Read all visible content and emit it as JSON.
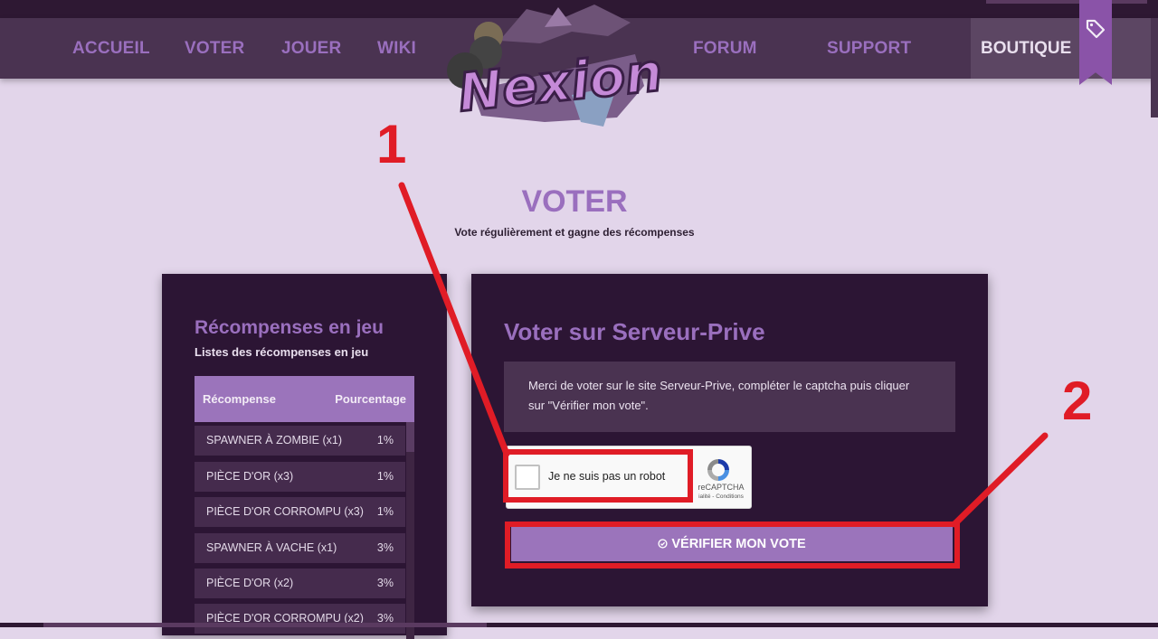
{
  "nav": {
    "items": [
      {
        "label": "ACCUEIL"
      },
      {
        "label": "VOTER"
      },
      {
        "label": "JOUER"
      },
      {
        "label": "WIKI"
      },
      {
        "label": "FORUM"
      },
      {
        "label": "SUPPORT"
      }
    ],
    "shop_label": "BOUTIQUE",
    "shop_icon": "tag-icon"
  },
  "logo": {
    "text": "Nexion"
  },
  "page": {
    "title": "VOTER",
    "subtitle": "Vote régulièrement et gagne des récompenses"
  },
  "rewards": {
    "title": "Récompenses en jeu",
    "subtitle": "Listes des récompenses en jeu",
    "col_reward": "Récompense",
    "col_percent": "Pourcentage",
    "rows": [
      {
        "name": "SPAWNER À ZOMBIE (x1)",
        "pct": "1%"
      },
      {
        "name": "PIÈCE D'OR (x3)",
        "pct": "1%"
      },
      {
        "name": "PIÈCE D'OR CORROMPU (x3)",
        "pct": "1%"
      },
      {
        "name": "SPAWNER À VACHE (x1)",
        "pct": "3%"
      },
      {
        "name": "PIÈCE D'OR (x2)",
        "pct": "3%"
      },
      {
        "name": "PIÈCE D'OR CORROMPU (x2)",
        "pct": "3%"
      }
    ]
  },
  "vote": {
    "title": "Voter sur Serveur-Prive",
    "info": "Merci de voter sur le site Serveur-Prive, compléter le captcha puis cliquer sur \"Vérifier mon vote\".",
    "captcha_label": "Je ne suis pas un robot",
    "captcha_brand": "reCAPTCHA",
    "captcha_terms": "ialité - Conditions",
    "verify_label": "VÉRIFIER MON VOTE"
  },
  "annotations": {
    "label_1": "1",
    "label_2": "2",
    "color": "#e01c26"
  },
  "colors": {
    "accent": "#9a6fbe",
    "panel": "#2c1534",
    "navbar": "#4a3351",
    "background": "#e2d5ea"
  }
}
